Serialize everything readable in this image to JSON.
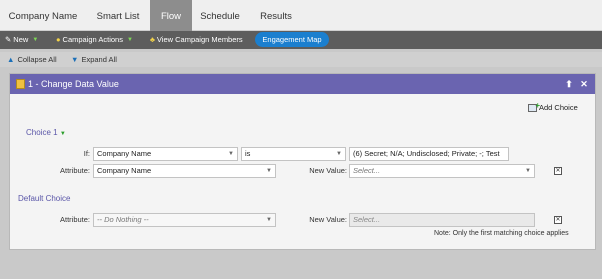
{
  "tabs": [
    {
      "label": "Company Name",
      "active": false
    },
    {
      "label": "Smart List",
      "active": false
    },
    {
      "label": "Flow",
      "active": true
    },
    {
      "label": "Schedule",
      "active": false
    },
    {
      "label": "Results",
      "active": false
    }
  ],
  "toolbar": {
    "new_label": "New",
    "campaign_actions_label": "Campaign Actions",
    "view_members_label": "View Campaign Members",
    "engagement_map_label": "Engagement Map"
  },
  "collapse_bar": {
    "collapse_all": "Collapse All",
    "expand_all": "Expand All"
  },
  "step": {
    "title": "1 - Change Data Value",
    "add_choice": "Add Choice",
    "choice1": {
      "label": "Choice 1",
      "if_label": "If:",
      "field": "Company Name",
      "operator": "is",
      "values": "(6) Secret; N/A; Undisclosed; Private; -; Test",
      "attribute_label": "Attribute:",
      "attribute": "Company Name",
      "new_value_label": "New Value:",
      "new_value_placeholder": "Select..."
    },
    "default_choice": {
      "label": "Default Choice",
      "attribute_label": "Attribute:",
      "attribute": "-- Do Nothing --",
      "new_value_label": "New Value:",
      "new_value_placeholder": "Select..."
    },
    "note": "Note: Only the first matching choice applies"
  },
  "colors": {
    "panel_header": "#6a64b0",
    "toolbar": "#5d5d5d",
    "accent_button": "#1b7fcf",
    "active_tab": "#8d8d8d"
  }
}
